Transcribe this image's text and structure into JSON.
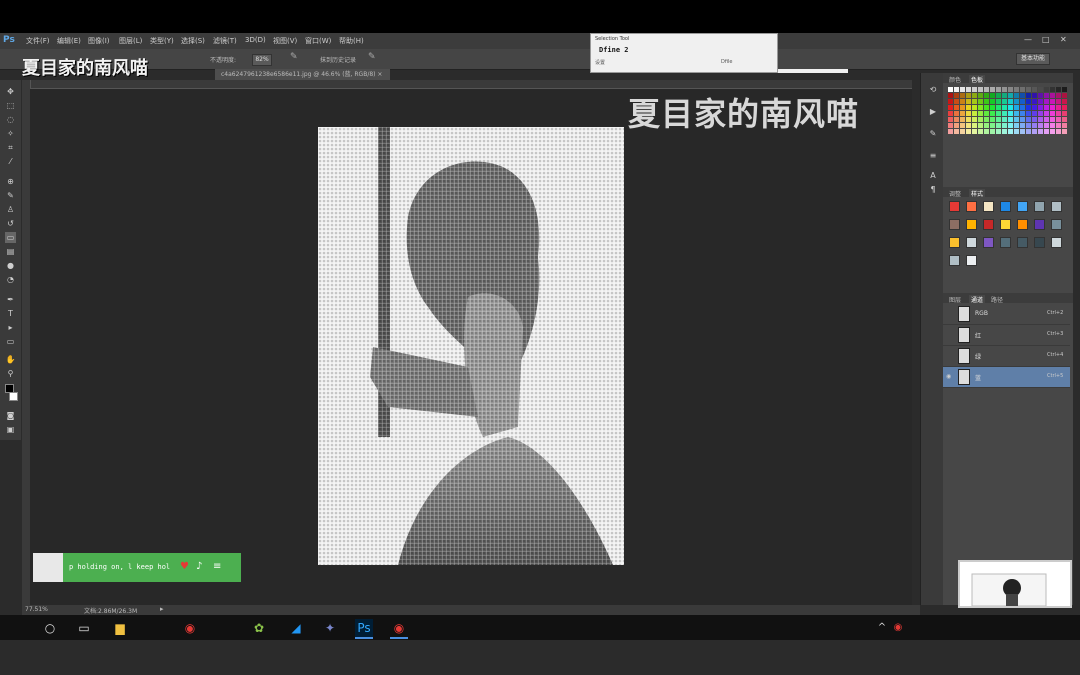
{
  "app": {
    "logo": "Ps"
  },
  "menubar": {
    "items": [
      "文件(F)",
      "编辑(E)",
      "图像(I)",
      "图层(L)",
      "类型(Y)",
      "选择(S)",
      "滤镜(T)",
      "3D(D)",
      "视图(V)",
      "窗口(W)",
      "帮助(H)"
    ],
    "window_controls": [
      "—",
      "□",
      "✕"
    ]
  },
  "optionsbar": {
    "opacity_label": "不透明度:",
    "opacity_value": "82%",
    "history_label": "抹到历史记录",
    "workspace": "基本功能"
  },
  "document_tab": {
    "title": "c4a6247961238e6586e11.jpg @ 46.6% (蓝, RGB/8) ×"
  },
  "watermark": {
    "right": "夏目家的南风喵",
    "left": "夏目家的南风喵"
  },
  "selection_tool": {
    "title": "Selection Tool",
    "name": "Dfine 2",
    "settings_label": "设置",
    "right_label": "Dfile"
  },
  "panels": {
    "color_tabs": [
      "颜色",
      "色板"
    ],
    "style_tabs": [
      "调整",
      "样式"
    ],
    "channel_tabs": [
      "图层",
      "通道",
      "路径"
    ],
    "channels": [
      {
        "name": "RGB",
        "shortcut": "Ctrl+2"
      },
      {
        "name": "红",
        "shortcut": "Ctrl+3"
      },
      {
        "name": "绿",
        "shortcut": "Ctrl+4"
      },
      {
        "name": "蓝",
        "shortcut": "Ctrl+5"
      }
    ]
  },
  "statusbar": {
    "zoom": "77.51%",
    "doc": "文档:2.86M/26.3M"
  },
  "music": {
    "lyric": "p holding on, l keep hol"
  },
  "colors": {
    "accent_green": "#4caf50",
    "selected_channel": "#5f7fa8"
  }
}
